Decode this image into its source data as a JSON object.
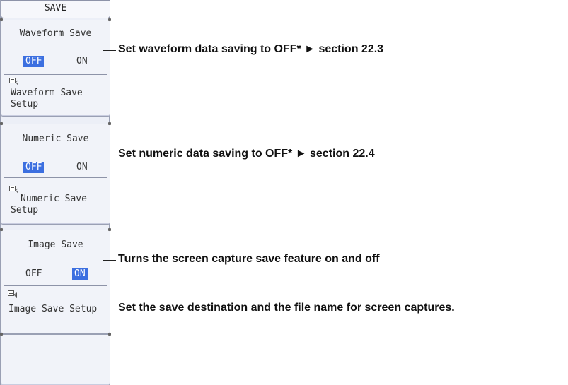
{
  "menu": {
    "title": "SAVE",
    "waveform": {
      "label": "Waveform Save",
      "off": "OFF",
      "on": "ON",
      "selected": "OFF",
      "setup_line1": "Waveform Save",
      "setup_line2": "Setup"
    },
    "numeric": {
      "label": "Numeric Save",
      "off": "OFF",
      "on": "ON",
      "selected": "OFF",
      "setup_line1": "Numeric Save",
      "setup_line2": "Setup"
    },
    "image": {
      "label": "Image Save",
      "off": "OFF",
      "on": "ON",
      "selected": "ON",
      "setup_line1": "Image Save Setup"
    }
  },
  "callouts": {
    "waveform_save": "Set waveform data saving to OFF* ► section 22.3",
    "numeric_save": "Set numeric data saving to OFF* ► section 22.4",
    "image_save": "Turns the screen capture save feature on and off",
    "image_setup": "Set the save destination and the file name for screen captures."
  },
  "colors": {
    "selected_bg": "#3c6fe0",
    "panel_bg": "#eceff7"
  }
}
